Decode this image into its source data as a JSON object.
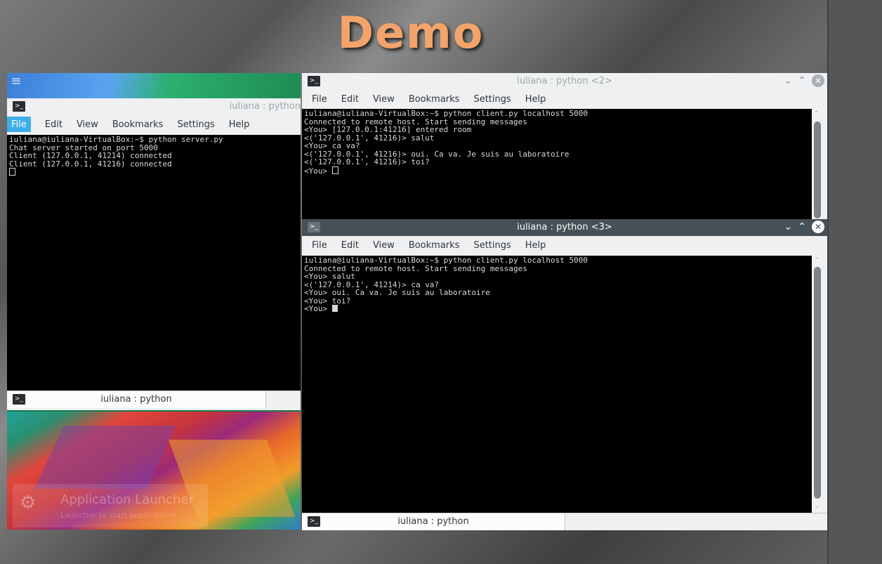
{
  "slide": {
    "title": "Demo"
  },
  "menu": [
    "File",
    "Edit",
    "View",
    "Bookmarks",
    "Settings",
    "Help"
  ],
  "server_window": {
    "title": "iuliana : python",
    "tab_label": "iuliana : python",
    "lines": [
      "iuliana@iuliana-VirtualBox:~$ python server.py",
      "Chat server started on port 5000",
      "Client (127.0.0.1, 41214) connected",
      "Client (127.0.0.1, 41216) connected"
    ]
  },
  "client2_window": {
    "title": "iuliana : python <2>",
    "lines": [
      "iuliana@iuliana-VirtualBox:~$ python client.py localhost 5000",
      "Connected to remote host. Start sending messages",
      "<You> [127.0.0.1:41216] entered room",
      "<('127.0.0.1', 41216)> salut",
      "<You> ca va?",
      "<('127.0.0.1', 41216)> oui. Ca va. Je suis au laboratoire",
      "<('127.0.0.1', 41216)> toi?",
      "<You> "
    ]
  },
  "client3_window": {
    "title": "iuliana : python <3>",
    "tab_label": "iuliana : python",
    "lines": [
      "iuliana@iuliana-VirtualBox:~$ python client.py localhost 5000",
      "Connected to remote host. Start sending messages",
      "<You> salut",
      "<('127.0.0.1', 41214)> ca va?",
      "<You> oui. Ca va. Je suis au laboratoire",
      "<You> toi?",
      "<You> "
    ]
  },
  "launcher": {
    "title": "Application Launcher",
    "subtitle": "Launcher to start applications"
  },
  "icons": {
    "terminal": "terminal-icon",
    "minimize": "chevron-down-icon",
    "maximize": "chevron-up-icon",
    "close": "close-icon",
    "menu": "hamburger-icon",
    "kde": "kde-logo-icon"
  }
}
